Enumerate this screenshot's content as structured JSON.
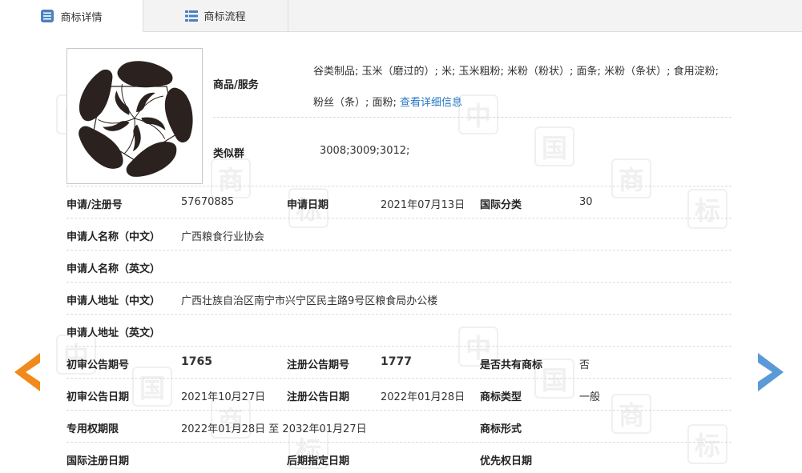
{
  "tabs": [
    {
      "label": "商标详情",
      "icon": "document-icon",
      "active": true
    },
    {
      "label": "商标流程",
      "icon": "list-icon",
      "active": false
    }
  ],
  "watermark": [
    "中",
    "国",
    "商",
    "标"
  ],
  "goods": {
    "label": "商品/服务",
    "text": "谷类制品; 玉米（磨过的）; 米; 玉米粗粉; 米粉（粉状）; 面条; 米粉（条状）; 食用淀粉; 粉丝（条）; 面粉;",
    "link": "查看详细信息"
  },
  "similar_group": {
    "label": "类似群",
    "value": "3008;3009;3012;"
  },
  "fields": {
    "reg_no": {
      "label": "申请/注册号",
      "value": "57670885"
    },
    "apply_date": {
      "label": "申请日期",
      "value": "2021年07月13日"
    },
    "intl_class": {
      "label": "国际分类",
      "value": "30"
    },
    "applicant_cn": {
      "label": "申请人名称（中文）",
      "value": "广西粮食行业协会"
    },
    "applicant_en": {
      "label": "申请人名称（英文）",
      "value": ""
    },
    "address_cn": {
      "label": "申请人地址（中文）",
      "value": "广西壮族自治区南宁市兴宁区民主路9号区粮食局办公楼"
    },
    "address_en": {
      "label": "申请人地址（英文）",
      "value": ""
    },
    "prelim_pub_no": {
      "label": "初审公告期号",
      "value": "1765"
    },
    "reg_pub_no": {
      "label": "注册公告期号",
      "value": "1777"
    },
    "shared": {
      "label": "是否共有商标",
      "value": "否"
    },
    "prelim_pub_date": {
      "label": "初审公告日期",
      "value": "2021年10月27日"
    },
    "reg_pub_date": {
      "label": "注册公告日期",
      "value": "2022年01月28日"
    },
    "tm_type": {
      "label": "商标类型",
      "value": "一般"
    },
    "exclusive_period": {
      "label": "专用权期限",
      "value": "2022年01月28日 至 2032年01月27日"
    },
    "tm_form": {
      "label": "商标形式",
      "value": ""
    },
    "intl_reg_date": {
      "label": "国际注册日期",
      "value": ""
    },
    "later_designation_date": {
      "label": "后期指定日期",
      "value": ""
    },
    "priority_date": {
      "label": "优先权日期",
      "value": ""
    }
  },
  "nav": {
    "prev_color": "#f08a1c",
    "next_color": "#5a9ad6"
  }
}
